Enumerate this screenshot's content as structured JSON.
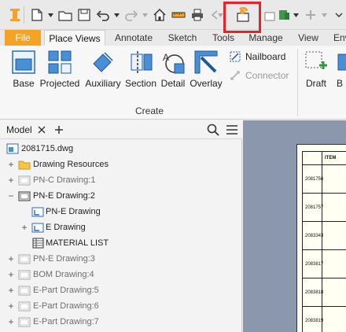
{
  "tabs": [
    {
      "label": "File"
    },
    {
      "label": "Place Views"
    },
    {
      "label": "Annotate"
    },
    {
      "label": "Sketch"
    },
    {
      "label": "Tools"
    },
    {
      "label": "Manage"
    },
    {
      "label": "View"
    },
    {
      "label": "Env"
    }
  ],
  "ribbon": {
    "buttons": [
      {
        "label": "Base"
      },
      {
        "label": "Projected"
      },
      {
        "label": "Auxiliary"
      },
      {
        "label": "Section"
      },
      {
        "label": "Detail"
      },
      {
        "label": "Overlay"
      }
    ],
    "nailboard": "Nailboard",
    "connector": "Connector",
    "draft": "Draft",
    "next": "B",
    "group_label": "Create"
  },
  "browser": {
    "tab": "Model",
    "file": "2081715.dwg",
    "items": [
      {
        "label": "Drawing Resources"
      },
      {
        "label": "PN-C Drawing:1"
      },
      {
        "label": "PN-E Drawing:2"
      },
      {
        "label": "PN-E Drawing"
      },
      {
        "label": "E Drawing"
      },
      {
        "label": "MATERIAL LIST"
      },
      {
        "label": "PN-E Drawing:3"
      },
      {
        "label": "BOM Drawing:4"
      },
      {
        "label": "E-Part Drawing:5"
      },
      {
        "label": "E-Part Drawing:6"
      },
      {
        "label": "E-Part Drawing:7"
      }
    ]
  },
  "sheet": {
    "header": "ITEM",
    "rows": [
      "2081756",
      "2081757",
      "2083343",
      "2083817",
      "2083818",
      "2083819"
    ]
  },
  "colors": {
    "accent": "#f5a325",
    "highlight": "#e5232b",
    "canvas": "#8a97ac"
  }
}
